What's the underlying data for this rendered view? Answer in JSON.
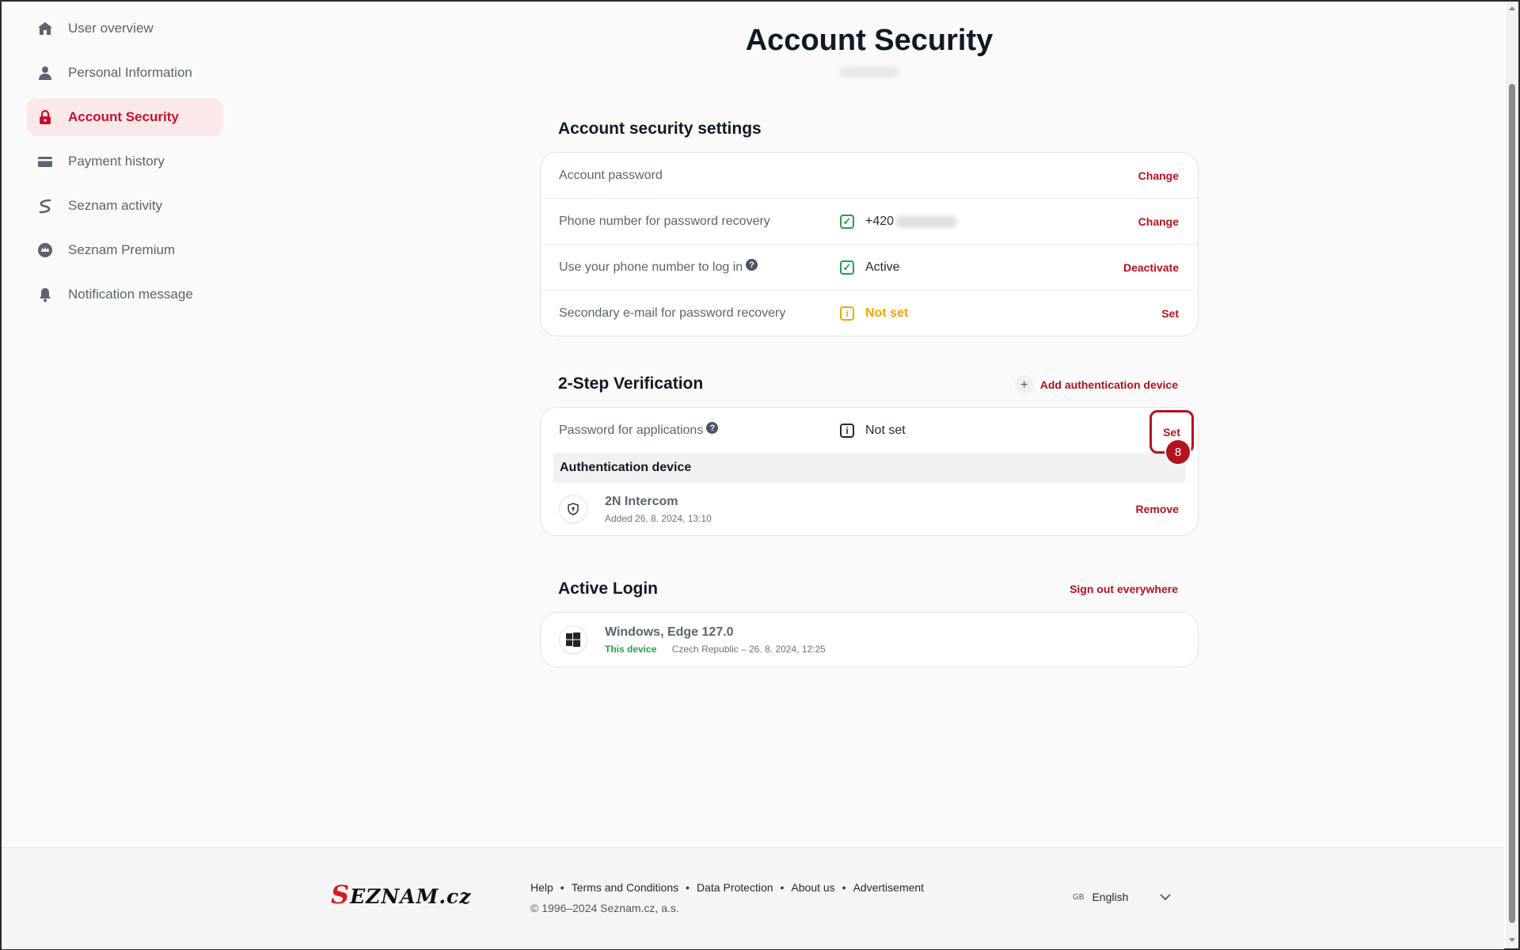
{
  "sidebar": {
    "items": [
      {
        "label": "User overview",
        "icon": "home-icon"
      },
      {
        "label": "Personal Information",
        "icon": "person-icon"
      },
      {
        "label": "Account Security",
        "icon": "lock-icon",
        "active": true
      },
      {
        "label": "Payment history",
        "icon": "card-icon"
      },
      {
        "label": "Seznam activity",
        "icon": "seznam-s-icon"
      },
      {
        "label": "Seznam Premium",
        "icon": "premium-icon"
      },
      {
        "label": "Notification message",
        "icon": "bell-icon"
      }
    ]
  },
  "page": {
    "title": "Account Security"
  },
  "security_settings": {
    "heading": "Account security settings",
    "rows": [
      {
        "label": "Account password",
        "status": "",
        "action": "Change"
      },
      {
        "label": "Phone number for password recovery",
        "status": "+420",
        "action": "Change"
      },
      {
        "label": "Use your phone number to log in",
        "status": "Active",
        "action": "Deactivate"
      },
      {
        "label": "Secondary e-mail for password recovery",
        "status": "Not set",
        "action": "Set"
      }
    ]
  },
  "two_step": {
    "heading": "2-Step Verification",
    "add_label": "Add authentication device",
    "app_password": {
      "label": "Password for applications",
      "status": "Not set",
      "action": "Set"
    },
    "device_heading": "Authentication device",
    "device": {
      "name": "2N Intercom",
      "added": "Added 26. 8. 2024, 13:10",
      "action": "Remove"
    },
    "highlight_badge": "8"
  },
  "active_login": {
    "heading": "Active Login",
    "sign_out": "Sign out everywhere",
    "session": {
      "name": "Windows, Edge 127.0",
      "this_device": "This device",
      "meta": "Czech Republic – 26. 8. 2024, 12:25"
    }
  },
  "footer": {
    "logo": "SEZNAM.cz",
    "links": [
      "Help",
      "Terms and Conditions",
      "Data Protection",
      "About us",
      "Advertisement"
    ],
    "copyright": "© 1996–2024 Seznam.cz, a.s.",
    "lang_code": "GB",
    "language": "English"
  },
  "colors": {
    "accent": "#b3121f",
    "success": "#22a04b",
    "warning": "#f0a500"
  }
}
